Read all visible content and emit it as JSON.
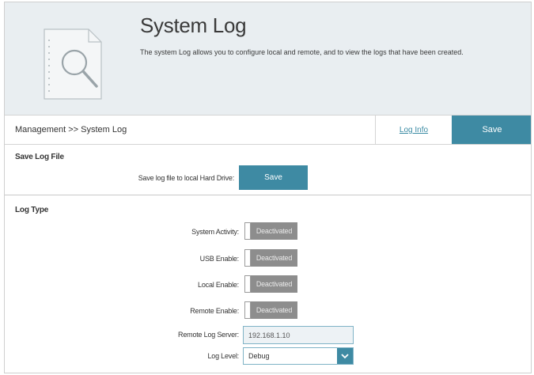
{
  "header": {
    "title": "System Log",
    "description": "The system Log allows you to configure local and remote, and to view the logs that have been created.",
    "icon": "document-search-icon"
  },
  "nav": {
    "breadcrumb": "Management >> System Log",
    "log_info_link": "Log Info",
    "save_label": "Save"
  },
  "save_log_file": {
    "heading": "Save Log File",
    "label": "Save log file to local Hard Drive:",
    "button_label": "Save"
  },
  "log_type": {
    "heading": "Log Type",
    "system_activity": {
      "label": "System Activity:",
      "state": "Deactivated"
    },
    "usb_enable": {
      "label": "USB Enable:",
      "state": "Deactivated"
    },
    "local_enable": {
      "label": "Local Enable:",
      "state": "Deactivated"
    },
    "remote_enable": {
      "label": "Remote Enable:",
      "state": "Deactivated"
    },
    "remote_log_server": {
      "label": "Remote Log Server:",
      "value": "192.168.1.10"
    },
    "log_level": {
      "label": "Log Level:",
      "value": "Debug"
    }
  },
  "colors": {
    "accent": "#3e8aa3",
    "banner_bg": "#e9eef1",
    "toggle_off": "#8d8d8d"
  }
}
